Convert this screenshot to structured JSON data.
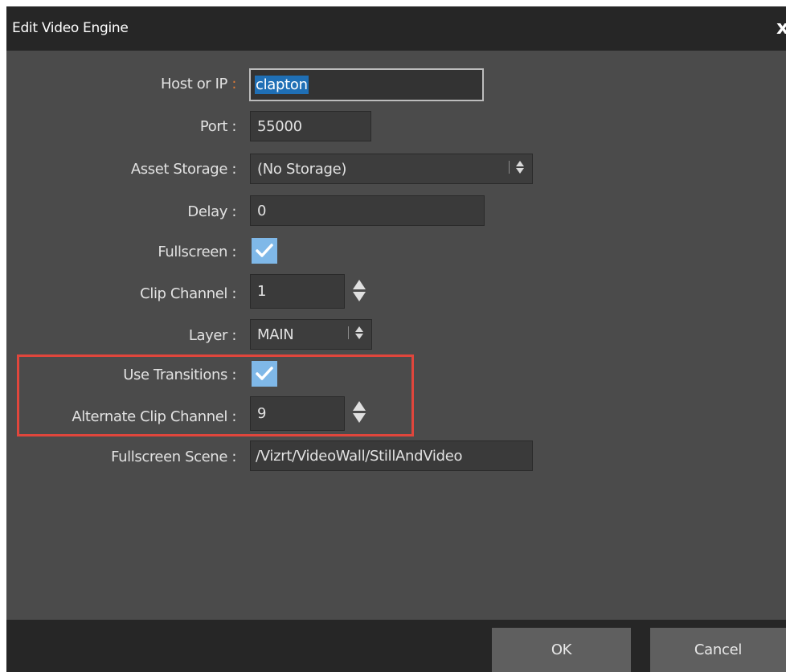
{
  "dialog": {
    "title": "Edit Video Engine",
    "close_glyph": "x"
  },
  "fields": {
    "host": {
      "label": "Host or IP",
      "colon": ":",
      "value": "clapton"
    },
    "port": {
      "label": "Port",
      "colon": ":",
      "value": "55000"
    },
    "asset_storage": {
      "label": "Asset Storage",
      "colon": ":",
      "value": "(No Storage)"
    },
    "delay": {
      "label": "Delay",
      "colon": ":",
      "value": "0"
    },
    "fullscreen": {
      "label": "Fullscreen",
      "colon": ":",
      "checked": true
    },
    "clip_channel": {
      "label": "Clip Channel",
      "colon": ":",
      "value": "1"
    },
    "layer": {
      "label": "Layer",
      "colon": ":",
      "value": "MAIN"
    },
    "use_transitions": {
      "label": "Use Transitions",
      "colon": ":",
      "checked": true
    },
    "alternate_clip_channel": {
      "label": "Alternate Clip Channel",
      "colon": ":",
      "value": "9"
    },
    "fullscreen_scene": {
      "label": "Fullscreen Scene",
      "colon": ":",
      "value": "/Vizrt/VideoWall/StillAndVideo"
    }
  },
  "buttons": {
    "ok": "OK",
    "cancel": "Cancel"
  },
  "colors": {
    "panel": "#4b4b4b",
    "titlebar": "#262626",
    "checkbox": "#7fb8e8",
    "selection": "#1f6fb5",
    "highlight_box": "#e0463c",
    "required_colon": "#e07a35"
  },
  "icons": {
    "checkbox": "checkmark-icon",
    "combo": "up-down-arrows-icon",
    "spinner": "spinner-arrows-icon",
    "close": "close-icon"
  }
}
